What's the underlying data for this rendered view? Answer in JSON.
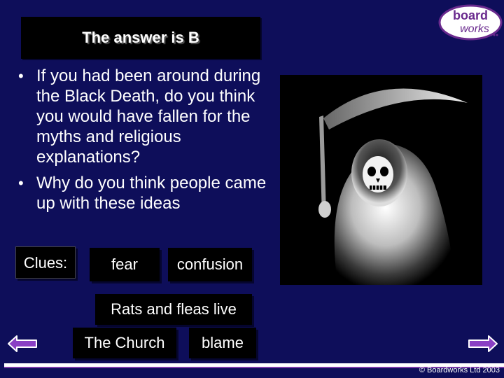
{
  "title": "The answer is B",
  "logo": {
    "line1": "board",
    "line2": "works",
    "icon": "boardworks-logo"
  },
  "bullets": [
    "If you had been around during the Black Death, do you think you would have fallen for the myths and religious explanations?",
    "Why do you think people came up with these ideas"
  ],
  "image": {
    "icon": "grim-reaper-illustration"
  },
  "clues": {
    "label": "Clues:",
    "fear": "fear",
    "confusion": "confusion",
    "rats": "Rats and fleas live",
    "church": "The Church",
    "blame": "blame"
  },
  "nav": {
    "prev_icon": "arrow-left-icon",
    "next_icon": "arrow-right-icon"
  },
  "footer": {
    "copyright": "© Boardworks Ltd 2003"
  },
  "colors": {
    "background": "#0e0e5a",
    "arrow": "#8a3fc4",
    "logo": "#6a2a8e"
  }
}
